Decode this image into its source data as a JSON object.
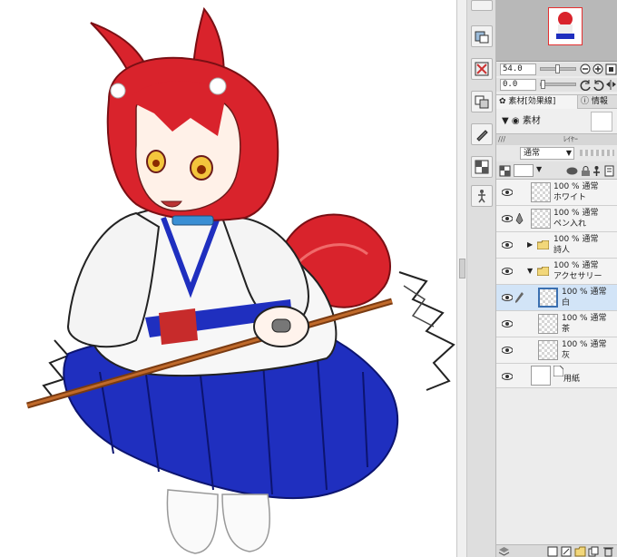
{
  "navigator": {
    "zoom_value": "54.0",
    "rotate_value": "0.0"
  },
  "tabs": [
    {
      "label": "素材[効果線]"
    },
    {
      "label": "情報"
    }
  ],
  "materials": {
    "label": "素材"
  },
  "layer_panel": {
    "header_left": "ﾚｲﾔｰ",
    "blend_mode": "通常"
  },
  "layers": [
    {
      "line1": "100 % 通常",
      "line2": "ホワイト",
      "type": "raster",
      "selected": false
    },
    {
      "line1": "100 % 通常",
      "line2": "ペン入れ",
      "type": "raster",
      "selected": false
    },
    {
      "line1": "100 % 通常",
      "line2": "詩人",
      "type": "folder",
      "expanded": false,
      "selected": false
    },
    {
      "line1": "100 % 通常",
      "line2": "アクセサリー",
      "type": "folder",
      "expanded": true,
      "selected": false
    },
    {
      "line1": "100 % 通常",
      "line2": "白",
      "type": "raster",
      "selected": true
    },
    {
      "line1": "100 % 通常",
      "line2": "茶",
      "type": "raster",
      "selected": false
    },
    {
      "line1": "100 % 通常",
      "line2": "灰",
      "type": "raster",
      "selected": false
    },
    {
      "line1": "",
      "line2": "用紙",
      "type": "paper",
      "selected": false
    }
  ],
  "colors": {
    "hair": "#d9232c",
    "robe_blue": "#1f2fbf",
    "selection": "#d2e4f7",
    "nav_frame": "#e53030"
  },
  "icons": {
    "eye": "eye-icon",
    "pen": "pen-icon",
    "folder": "folder-icon",
    "zoom_in": "zoom-in-icon",
    "zoom_out": "zoom-out-icon"
  }
}
